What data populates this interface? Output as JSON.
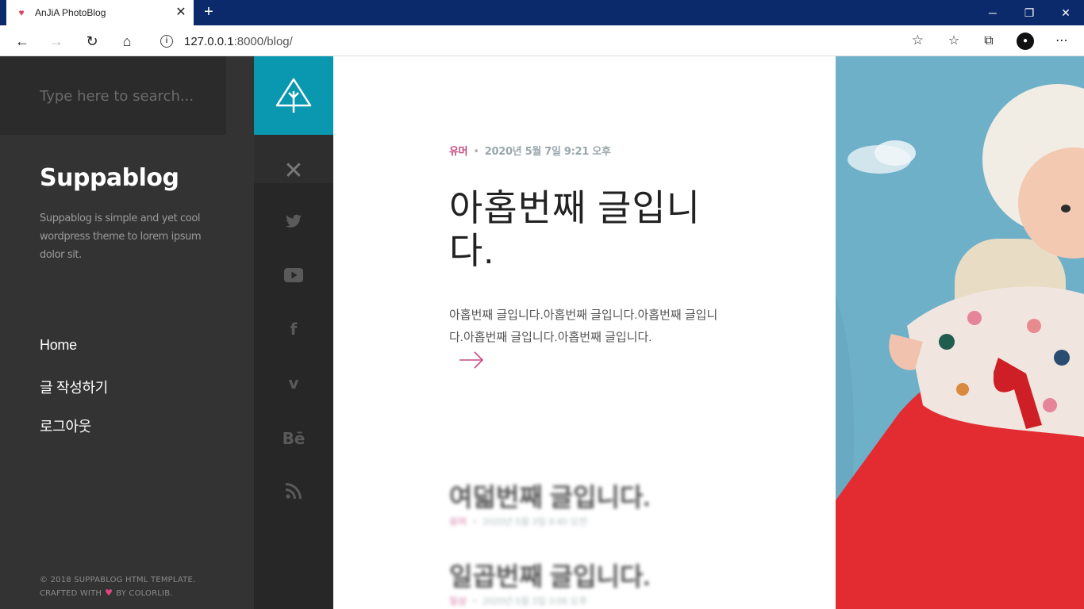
{
  "browser": {
    "tab_title": "AnJiA PhotoBlog",
    "url_host": "127.0.0.1",
    "url_rest": ":8000/blog/"
  },
  "search": {
    "placeholder": "Type here to search..."
  },
  "brand": {
    "name": "Suppablog",
    "tagline": "Suppablog is simple and yet cool wordpress theme to lorem ipsum dolor sit."
  },
  "menu": [
    {
      "label": "Home"
    },
    {
      "label": "글 작성하기"
    },
    {
      "label": "로그아웃"
    }
  ],
  "footer": {
    "line1": "© 2018 SUPPABLOG HTML TEMPLATE.",
    "line2_a": "CRAFTED WITH",
    "line2_b": "BY COLORLIB."
  },
  "social_icons": [
    "twitter-icon",
    "youtube-icon",
    "facebook-icon",
    "vimeo-icon",
    "behance-icon",
    "rss-icon"
  ],
  "posts": [
    {
      "category": "유머",
      "date": "2020년 5월 7일 9:21 오후",
      "title": "아홉번째 글입니다.",
      "excerpt": "아홉번째 글입니다.아홉번째 글입니다.아홉번째 글입니다.아홉번째 글입니다.아홉번째 글입니다."
    },
    {
      "category": "유머",
      "date": "2020년 5월 3일 8:40 오전",
      "title": "여덟번째 글입니다."
    },
    {
      "category": "일상",
      "date": "2020년 5월 3일 3:08 오후",
      "title": "일곱번째 글입니다."
    }
  ],
  "colors": {
    "accent": "#0a97b0",
    "category": "#c34d83",
    "sidebar": "#333333"
  }
}
